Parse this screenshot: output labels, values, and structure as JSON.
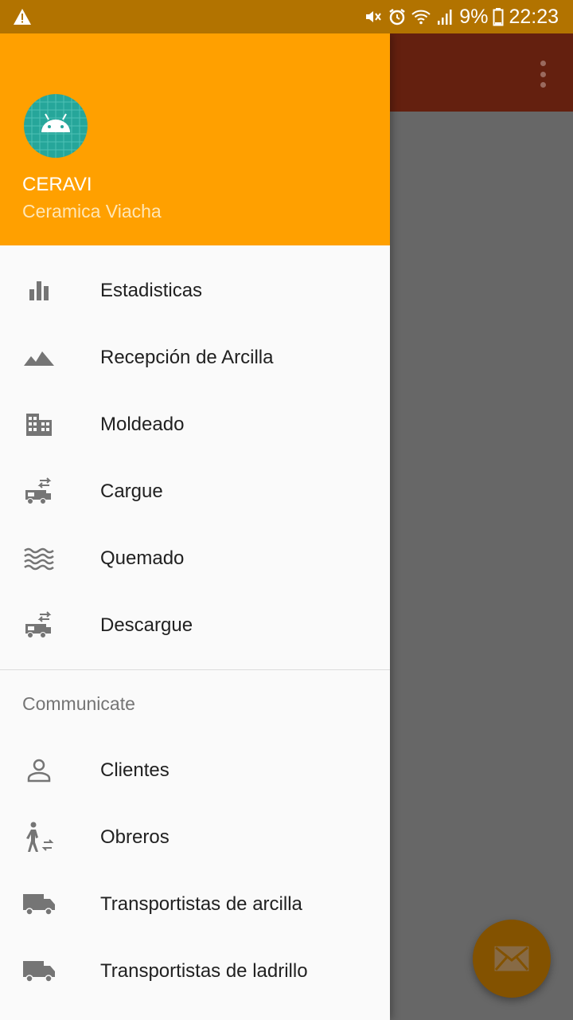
{
  "status_bar": {
    "battery_percent": "9%",
    "time": "22:23",
    "icons": [
      "warning-icon",
      "mute-icon",
      "alarm-icon",
      "wifi-icon",
      "signal-icon",
      "battery-icon"
    ]
  },
  "app_bar": {
    "menu_icon": "more-vert-icon"
  },
  "drawer": {
    "header": {
      "title": "CERAVI",
      "subtitle": "Ceramica Viacha",
      "avatar_icon": "android-icon"
    },
    "items": [
      {
        "label": "Estadisticas",
        "icon": "bar-chart-icon"
      },
      {
        "label": "Recepción de Arcilla",
        "icon": "terrain-icon"
      },
      {
        "label": "Moldeado",
        "icon": "building-icon"
      },
      {
        "label": "Cargue",
        "icon": "rv-transfer-icon"
      },
      {
        "label": "Quemado",
        "icon": "waves-icon"
      },
      {
        "label": "Descargue",
        "icon": "rv-transfer-icon"
      }
    ],
    "section_title": "Communicate",
    "communicate_items": [
      {
        "label": "Clientes",
        "icon": "person-icon"
      },
      {
        "label": "Obreros",
        "icon": "walker-transfer-icon"
      },
      {
        "label": "Transportistas de arcilla",
        "icon": "truck-icon"
      },
      {
        "label": "Transportistas de ladrillo",
        "icon": "truck-icon"
      }
    ]
  },
  "fab": {
    "icon": "mail-icon"
  },
  "colors": {
    "status_bar": "#b27300",
    "drawer_header": "#ffa000",
    "app_bar": "#64200f",
    "fab": "#835200",
    "icon_gray": "#757575"
  }
}
